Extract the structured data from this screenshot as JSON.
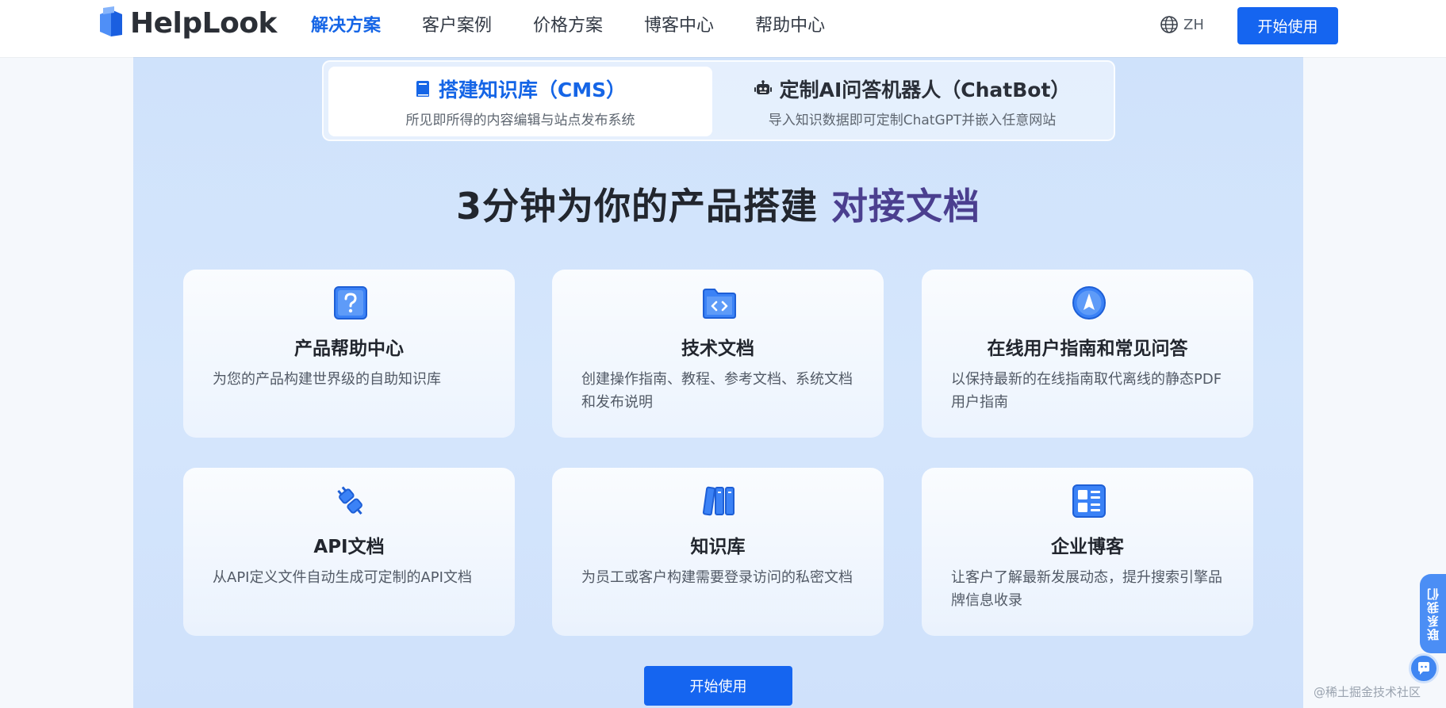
{
  "header": {
    "brand": "HelpLook",
    "nav": [
      {
        "label": "解决方案",
        "active": true
      },
      {
        "label": "客户案例",
        "active": false
      },
      {
        "label": "价格方案",
        "active": false
      },
      {
        "label": "博客中心",
        "active": false
      },
      {
        "label": "帮助中心",
        "active": false
      }
    ],
    "language": "ZH",
    "cta_label": "开始使用"
  },
  "tabs": [
    {
      "icon": "book-icon",
      "title": "搭建知识库（CMS）",
      "subtitle": "所见即所得的内容编辑与站点发布系统",
      "selected": true
    },
    {
      "icon": "robot-icon",
      "title": "定制AI问答机器人（ChatBot）",
      "subtitle": "导入知识数据即可定制ChatGPT并嵌入任意网站",
      "selected": false
    }
  ],
  "headline": {
    "main": "3分钟为你的产品搭建 ",
    "accent": "对接文档"
  },
  "cards": [
    {
      "icon": "question-icon",
      "title": "产品帮助中心",
      "desc": "为您的产品构建世界级的自助知识库"
    },
    {
      "icon": "code-folder-icon",
      "title": "技术文档",
      "desc": "创建操作指南、教程、参考文档、系统文档和发布说明"
    },
    {
      "icon": "compass-icon",
      "title": "在线用户指南和常见问答",
      "desc": "以保持最新的在线指南取代离线的静态PDF用户指南"
    },
    {
      "icon": "plug-icon",
      "title": "API文档",
      "desc": "从API定义文件自动生成可定制的API文档"
    },
    {
      "icon": "library-icon",
      "title": "知识库",
      "desc": "为员工或客户构建需要登录访问的私密文档"
    },
    {
      "icon": "layout-icon",
      "title": "企业博客",
      "desc": "让客户了解最新发展动态，提升搜索引擎品牌信息收录"
    }
  ],
  "bottom_cta_label": "开始使用",
  "side": {
    "contact_label": "联系我们"
  },
  "watermark": "@稀土掘金技术社区",
  "colors": {
    "brand_blue": "#1565f0",
    "accent_purple": "#4b3f8f",
    "section_bg": "#cfe2fb"
  }
}
